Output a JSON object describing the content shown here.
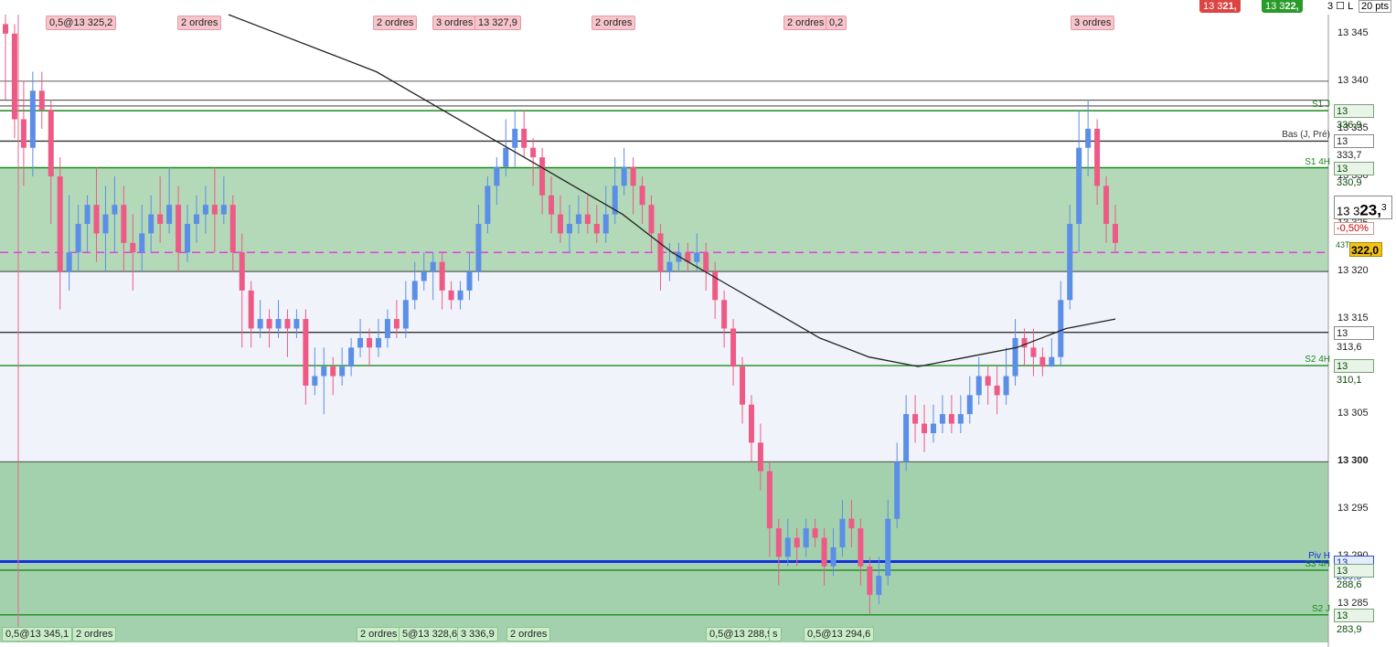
{
  "chart_data": {
    "type": "candlestick",
    "ylim": [
      13281,
      13347
    ],
    "y_ticks": [
      "13 345",
      "13 340",
      "13 335",
      "13 330",
      "13 325",
      "13 320",
      "13 315",
      "13 310",
      "13 305",
      "13 300",
      "13 295",
      "13 290",
      "13 285"
    ],
    "bold_tick": "13 300",
    "current_price_label": "13 3",
    "current_price_big": "23,",
    "current_price_small": "3",
    "change_pct": "-0,50%",
    "ask_label": "43T",
    "ask_value": "322,0",
    "levels": [
      {
        "name": "S1 J",
        "box": "13 336,9",
        "value": 13336.9,
        "color": "#1a8a1a"
      },
      {
        "name": "Bas (J, Pré)",
        "box": "13 333,7",
        "value": 13333.7,
        "color": "#333333"
      },
      {
        "name": "S1 4H",
        "box": "13 330,9",
        "value": 13330.9,
        "color": "#1a8a1a"
      },
      {
        "name": "",
        "box": "13 313,6",
        "value": 13313.6,
        "color": "#333333"
      },
      {
        "name": "S2 4H",
        "box": "13 310,1",
        "value": 13310.1,
        "color": "#1a8a1a"
      },
      {
        "name": "Piv H",
        "box": "13 289,5",
        "value": 13289.5,
        "color": "#1030e0"
      },
      {
        "name": "S3 4H",
        "box": "13 288,6",
        "value": 13288.6,
        "color": "#1a8a1a"
      },
      {
        "name": "S2 J",
        "box": "13 283,9",
        "value": 13283.9,
        "color": "#1a8a1a"
      }
    ],
    "top_tags": [
      "0,5@13 325,2",
      "2 ordres",
      "2 ordres",
      "3 ordres",
      "13 327,9",
      "2 ordres",
      "2 ordres",
      "0,2",
      "3 ordres"
    ],
    "bottom_tags": [
      "0,5@13 345,1",
      "2 ordres",
      "2 ordres",
      "5@13 328,6",
      "3 336,9",
      "2 ordres",
      "0,5@13 288,9",
      "s",
      "0,5@13 294,6"
    ],
    "candles": [
      [
        13346,
        13345,
        13347,
        13338
      ],
      [
        13345,
        13336,
        13346,
        13334
      ],
      [
        13336,
        13333,
        13340,
        13329
      ],
      [
        13333,
        13339,
        13341,
        13330
      ],
      [
        13339,
        13337,
        13341,
        13335
      ],
      [
        13337,
        13330,
        13338,
        13325
      ],
      [
        13330,
        13320,
        13332,
        13316
      ],
      [
        13320,
        13322,
        13328,
        13318
      ],
      [
        13322,
        13325,
        13327,
        13320
      ],
      [
        13325,
        13327,
        13328,
        13322
      ],
      [
        13327,
        13324,
        13331,
        13321
      ],
      [
        13324,
        13326,
        13329,
        13320
      ],
      [
        13326,
        13327,
        13330,
        13322
      ],
      [
        13327,
        13323,
        13329,
        13320
      ],
      [
        13323,
        13322,
        13326,
        13318
      ],
      [
        13322,
        13324,
        13327,
        13320
      ],
      [
        13324,
        13326,
        13328,
        13322
      ],
      [
        13326,
        13325,
        13330,
        13323
      ],
      [
        13325,
        13327,
        13331,
        13324
      ],
      [
        13327,
        13322,
        13329,
        13320
      ],
      [
        13322,
        13325,
        13327,
        13321
      ],
      [
        13325,
        13326,
        13328,
        13323
      ],
      [
        13326,
        13327,
        13329,
        13324
      ],
      [
        13327,
        13326,
        13331,
        13322
      ],
      [
        13326,
        13327,
        13330,
        13325
      ],
      [
        13327,
        13322,
        13328,
        13320
      ],
      [
        13322,
        13318,
        13324,
        13312
      ],
      [
        13318,
        13314,
        13319,
        13312
      ],
      [
        13314,
        13315,
        13317,
        13313
      ],
      [
        13315,
        13314,
        13316,
        13312
      ],
      [
        13314,
        13315,
        13317,
        13313
      ],
      [
        13315,
        13314,
        13316,
        13311
      ],
      [
        13314,
        13315,
        13316,
        13313
      ],
      [
        13315,
        13308,
        13316,
        13306
      ],
      [
        13308,
        13309,
        13312,
        13307
      ],
      [
        13309,
        13310,
        13312,
        13305
      ],
      [
        13310,
        13309,
        13311,
        13307
      ],
      [
        13309,
        13310,
        13312,
        13308
      ],
      [
        13310,
        13312,
        13313,
        13309
      ],
      [
        13312,
        13313,
        13315,
        13311
      ],
      [
        13313,
        13312,
        13314,
        13310
      ],
      [
        13312,
        13313,
        13315,
        13311
      ],
      [
        13313,
        13315,
        13316,
        13312
      ],
      [
        13315,
        13314,
        13317,
        13313
      ],
      [
        13314,
        13317,
        13319,
        13313
      ],
      [
        13317,
        13319,
        13321,
        13316
      ],
      [
        13319,
        13320,
        13322,
        13318
      ],
      [
        13320,
        13321,
        13322,
        13317
      ],
      [
        13321,
        13318,
        13322,
        13316
      ],
      [
        13318,
        13317,
        13319,
        13316
      ],
      [
        13317,
        13318,
        13319,
        13316
      ],
      [
        13318,
        13320,
        13322,
        13317
      ],
      [
        13320,
        13325,
        13327,
        13319
      ],
      [
        13325,
        13329,
        13330,
        13324
      ],
      [
        13329,
        13331,
        13332,
        13327
      ],
      [
        13331,
        13333,
        13336,
        13330
      ],
      [
        13333,
        13335,
        13337,
        13331
      ],
      [
        13335,
        13333,
        13337,
        13332
      ],
      [
        13333,
        13332,
        13334,
        13329
      ],
      [
        13332,
        13328,
        13333,
        13326
      ],
      [
        13328,
        13326,
        13330,
        13324
      ],
      [
        13326,
        13324,
        13328,
        13323
      ],
      [
        13324,
        13325,
        13327,
        13322
      ],
      [
        13325,
        13326,
        13328,
        13324
      ],
      [
        13326,
        13325,
        13328,
        13324
      ],
      [
        13325,
        13324,
        13327,
        13323
      ],
      [
        13324,
        13326,
        13329,
        13323
      ],
      [
        13326,
        13329,
        13332,
        13325
      ],
      [
        13329,
        13331,
        13333,
        13328
      ],
      [
        13331,
        13329,
        13332,
        13326
      ],
      [
        13329,
        13327,
        13330,
        13325
      ],
      [
        13327,
        13324,
        13328,
        13322
      ],
      [
        13324,
        13320,
        13325,
        13318
      ],
      [
        13320,
        13321,
        13323,
        13319
      ],
      [
        13321,
        13322,
        13323,
        13320
      ],
      [
        13322,
        13321,
        13323,
        13320
      ],
      [
        13321,
        13322,
        13324,
        13320
      ],
      [
        13322,
        13320,
        13323,
        13318
      ],
      [
        13320,
        13317,
        13321,
        13315
      ],
      [
        13317,
        13314,
        13318,
        13312
      ],
      [
        13314,
        13310,
        13315,
        13308
      ],
      [
        13310,
        13306,
        13311,
        13304
      ],
      [
        13306,
        13302,
        13307,
        13300
      ],
      [
        13302,
        13299,
        13304,
        13297
      ],
      [
        13299,
        13293,
        13300,
        13290
      ],
      [
        13293,
        13290,
        13294,
        13287
      ],
      [
        13290,
        13292,
        13294,
        13289
      ],
      [
        13292,
        13291,
        13293,
        13289
      ],
      [
        13291,
        13293,
        13294,
        13290
      ],
      [
        13293,
        13292,
        13294,
        13291
      ],
      [
        13292,
        13289,
        13293,
        13287
      ],
      [
        13289,
        13291,
        13293,
        13288
      ],
      [
        13291,
        13294,
        13296,
        13290
      ],
      [
        13294,
        13293,
        13296,
        13291
      ],
      [
        13293,
        13289,
        13294,
        13287
      ],
      [
        13289,
        13286,
        13290,
        13284
      ],
      [
        13286,
        13288,
        13290,
        13285
      ],
      [
        13288,
        13294,
        13296,
        13287
      ],
      [
        13294,
        13300,
        13302,
        13293
      ],
      [
        13300,
        13305,
        13307,
        13299
      ],
      [
        13305,
        13304,
        13307,
        13302
      ],
      [
        13304,
        13303,
        13306,
        13301
      ],
      [
        13303,
        13304,
        13306,
        13302
      ],
      [
        13304,
        13305,
        13307,
        13303
      ],
      [
        13305,
        13304,
        13307,
        13303
      ],
      [
        13304,
        13305,
        13307,
        13303
      ],
      [
        13305,
        13307,
        13309,
        13304
      ],
      [
        13307,
        13309,
        13311,
        13306
      ],
      [
        13309,
        13308,
        13310,
        13306
      ],
      [
        13308,
        13307,
        13310,
        13305
      ],
      [
        13307,
        13309,
        13312,
        13306
      ],
      [
        13309,
        13313,
        13315,
        13308
      ],
      [
        13313,
        13312,
        13314,
        13310
      ],
      [
        13312,
        13311,
        13314,
        13309
      ],
      [
        13311,
        13310,
        13312,
        13309
      ],
      [
        13310,
        13311,
        13313,
        13310
      ],
      [
        13311,
        13317,
        13319,
        13310
      ],
      [
        13317,
        13325,
        13327,
        13316
      ],
      [
        13325,
        13333,
        13337,
        13322
      ],
      [
        13333,
        13335,
        13338,
        13330
      ],
      [
        13335,
        13329,
        13336,
        13327
      ],
      [
        13329,
        13325,
        13330,
        13323
      ],
      [
        13325,
        13323,
        13327,
        13322
      ]
    ],
    "ma": [
      13347,
      13345,
      13343,
      13341,
      13338,
      13335,
      13332,
      13329,
      13326,
      13322,
      13319,
      13316,
      13313,
      13311,
      13310,
      13311,
      13312,
      13314,
      13315
    ]
  }
}
